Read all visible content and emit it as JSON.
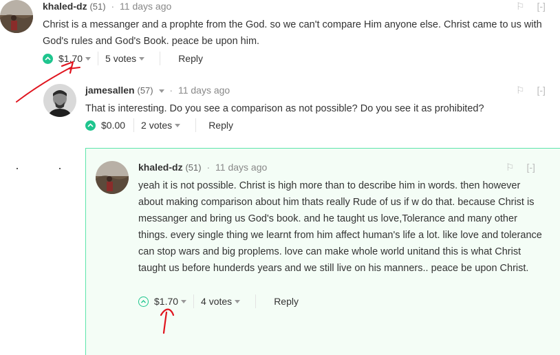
{
  "comments": [
    {
      "author": "khaled-dz",
      "reputation": "(51)",
      "time": "11 days ago",
      "body": "Christ is a messanger and a prophte from the God. so we can't compare Him anyone else. Christ came to us with God's rules and God's Book. peace be upon him.",
      "payout": "$1.70",
      "votes": "5 votes",
      "reply": "Reply",
      "collapse": "[-]"
    },
    {
      "author": "jamesallen",
      "reputation": "(57)",
      "time": "11 days ago",
      "body": "That is interesting. Do you see a comparison as not possible? Do you see it as prohibited?",
      "payout": "$0.00",
      "votes": "2 votes",
      "reply": "Reply",
      "collapse": "[-]"
    },
    {
      "author": "khaled-dz",
      "reputation": "(51)",
      "time": "11 days ago",
      "body": "yeah it is not possible. Christ is high more than to describe him in words. then however about making comparison about him thats really Rude of us if w do that. because Christ is messanger and bring us God's book. and he taught us love,Tolerance and many other things. every single thing we learnt from him affect human's life a lot. like love and tolerance can stop wars and big proplems. love can make whole world unitand this is what Christ taught us before hunderds years and we still live on his manners.. peace be upon Christ.",
      "payout": "$1.70",
      "votes": "4 votes",
      "reply": "Reply",
      "collapse": "[-]"
    }
  ],
  "colors": {
    "upvote_green": "#1fc58e",
    "highlight_border": "#5be5aa",
    "highlight_bg": "#f4fdf6",
    "annotation_red": "#e0141e"
  }
}
